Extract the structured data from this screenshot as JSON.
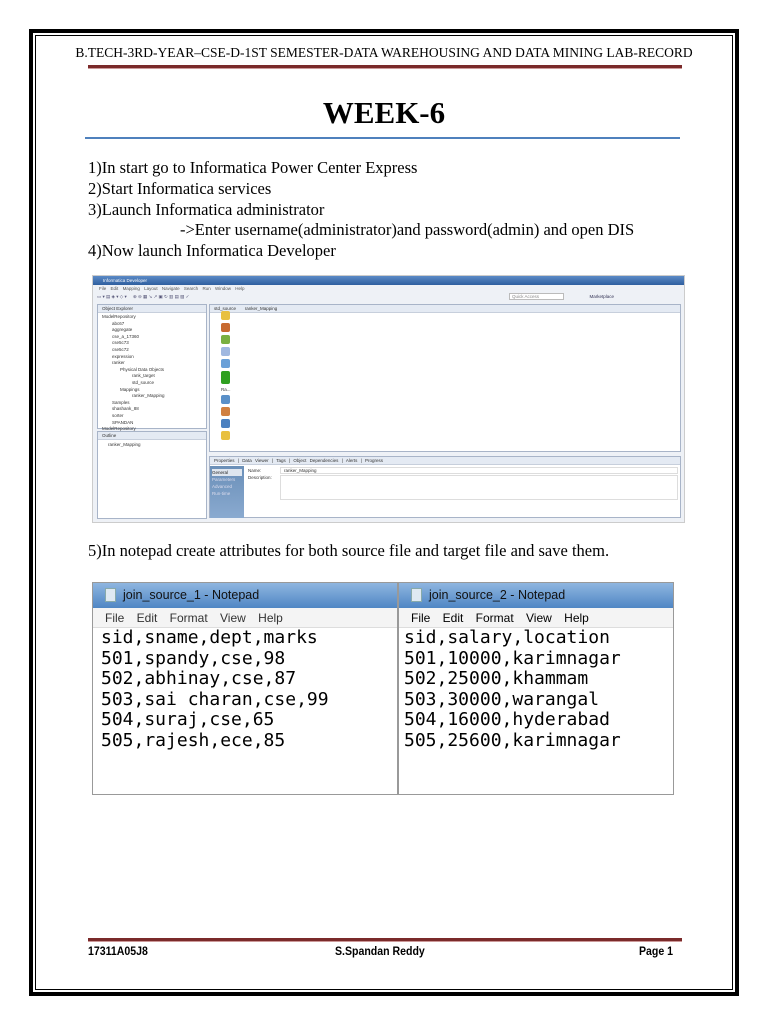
{
  "header": "B.TECH-3RD-YEAR–CSE-D-1ST SEMESTER-DATA WAREHOUSING AND DATA MINING LAB-RECORD",
  "title": "WEEK-6",
  "steps": [
    "1)In start go to Informatica Power Center Express",
    "2)Start Informatica services",
    "3)Launch Informatica administrator",
    "->Enter username(administrator)and password(admin) and open DIS",
    "4)Now launch Informatica Developer"
  ],
  "informatica": {
    "window_title": "Informatica Developer",
    "menu": [
      "File",
      "Edit",
      "Mapping",
      "Layout",
      "Navigate",
      "Search",
      "Run",
      "Window",
      "Help"
    ],
    "quick_access": "Quick Access",
    "marketplace": "Marketplace",
    "object_explorer": "Object Explorer",
    "tree": [
      "ModelRepository",
      "abc67",
      "aggregate",
      "cse_a_17360",
      "cse5c73",
      "cse5c72",
      "expression",
      "ranker",
      "Physical Data Objects",
      "rank_target",
      "std_source",
      "Mappings",
      "ranker_Mapping",
      "Samples",
      "shashank_88",
      "sorter",
      "SPANDAN",
      "ModelRepository",
      "ModelRepository"
    ],
    "editor_tabs": [
      "std_source",
      "ranker_Mapping"
    ],
    "palette_label": "Ra...",
    "outline": "Outline",
    "outline_item": "ranker_Mapping",
    "default_view": "(Default View)",
    "bottom_tabs": [
      "Properties",
      "Data Viewer",
      "Tags",
      "Object Dependencies",
      "Alerts",
      "Progress"
    ],
    "side_tabs": [
      "General",
      "Parameters",
      "Advanced",
      "Run-time"
    ],
    "name_label": "Name:",
    "name_value": "ranker_Mapping",
    "description_label": "Description:"
  },
  "step5": "5)In notepad create attributes for both source file and target file and save them.",
  "notepad1": {
    "title": "join_source_1 - Notepad",
    "menu": "File Edit Format View Help",
    "lines": [
      "sid,sname,dept,marks",
      "501,spandy,cse,98",
      "502,abhinay,cse,87",
      "503,sai charan,cse,99",
      "504,suraj,cse,65",
      "505,rajesh,ece,85"
    ]
  },
  "notepad2": {
    "title": "join_source_2 - Notepad",
    "menu": "File Edit Format View Help",
    "lines": [
      "sid,salary,location",
      "501,10000,karimnagar",
      "502,25000,khammam",
      "503,30000,warangal",
      "504,16000,hyderabad",
      "505,25600,karimnagar"
    ]
  },
  "footer": {
    "left": "17311A05J8",
    "center": "S.Spandan Reddy",
    "right": "Page 1"
  },
  "colors": {
    "rule": "#7a2a2a",
    "title_rule": "#4f81bd"
  }
}
